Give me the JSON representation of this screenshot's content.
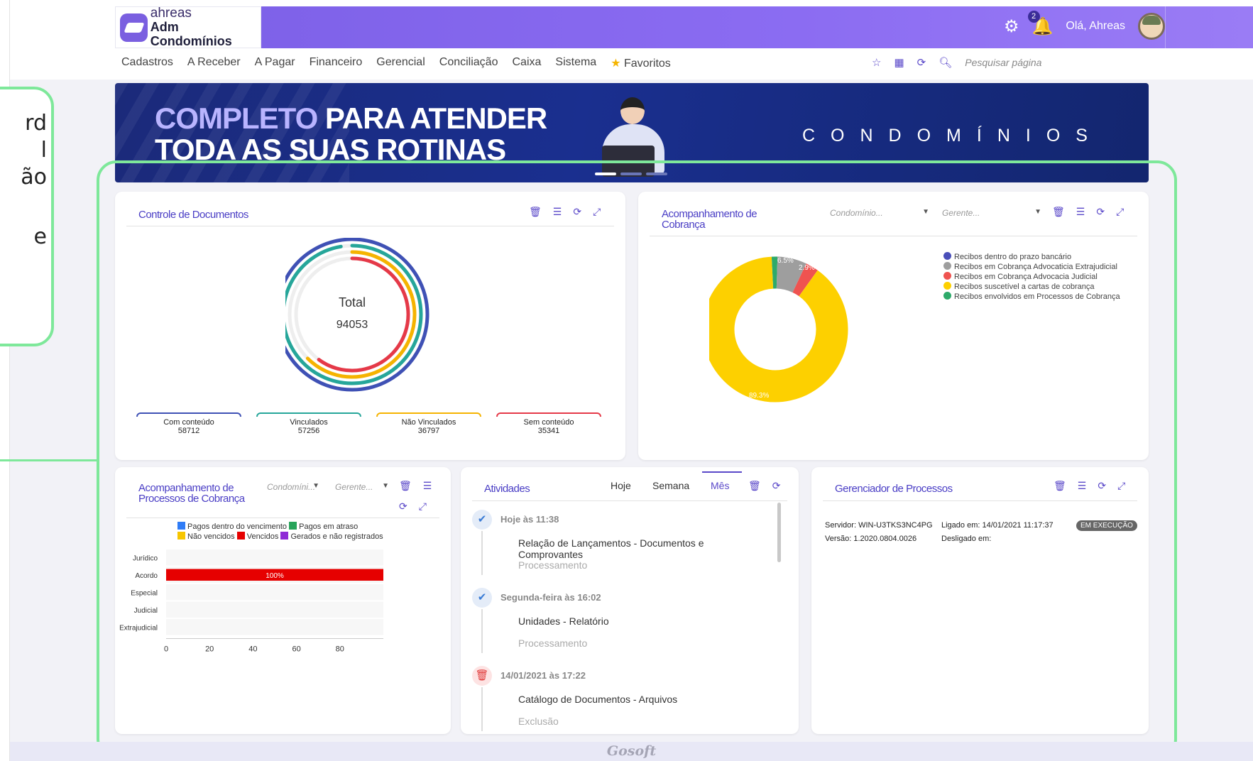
{
  "callout": {
    "lines": [
      "rd",
      "l",
      "ão",
      "",
      "e"
    ]
  },
  "header": {
    "brand_line1": "ahreas",
    "brand_line2": "Adm Condomínios",
    "notification_count": "2",
    "greeting": "Olá, Ahreas"
  },
  "menu": {
    "items": [
      "Cadastros",
      "A Receber",
      "A Pagar",
      "Financeiro",
      "Gerencial",
      "Conciliação",
      "Caixa",
      "Sistema"
    ],
    "favorites": "Favoritos",
    "search_placeholder": "Pesquisar página"
  },
  "banner": {
    "highlight": "COMPLETO",
    "line1_rest": " PARA ATENDER",
    "line2": "TODA AS SUAS ROTINAS",
    "right_text": "CONDOMÍNIOS"
  },
  "card_documentos": {
    "title": "Controle de Documentos",
    "center_label": "Total",
    "center_value": "94053",
    "legend": [
      {
        "label": "Com conteúdo",
        "value": "58712",
        "color": "#3f51b5"
      },
      {
        "label": "Vinculados",
        "value": "57256",
        "color": "#26a69a"
      },
      {
        "label": "Não Vinculados",
        "value": "36797",
        "color": "#f5b301"
      },
      {
        "label": "Sem conteúdo",
        "value": "35341",
        "color": "#e53948"
      }
    ]
  },
  "card_cobranca": {
    "title": "Acompanhamento de Cobrança",
    "select1": "Condomínio...",
    "select2": "Gerente...",
    "legend": [
      {
        "label": "Recibos dentro do prazo bancário",
        "color": "#4a4fb9"
      },
      {
        "label": "Recibos em Cobrança Advocaticia Extrajudicial",
        "color": "#9e9e9e"
      },
      {
        "label": "Recibos em Cobrança Advocacia Judicial",
        "color": "#ef5350"
      },
      {
        "label": "Recibos suscetível a cartas de cobrança",
        "color": "#fdd000"
      },
      {
        "label": "Recibos envolvidos em Processos de Cobrança",
        "color": "#2eaa6a"
      }
    ],
    "slices": [
      {
        "name": "Recibos envolvidos em Processos de Cobrança",
        "value": 1.3,
        "color": "#2eaa6a"
      },
      {
        "name": "Recibos em Cobrança Advocaticia Extrajudicial",
        "value": 6.5,
        "color": "#9e9e9e"
      },
      {
        "name": "Recibos em Cobrança Advocacia Judicial",
        "value": 2.9,
        "color": "#ef5350"
      },
      {
        "name": "Recibos suscetível a cartas de cobrança",
        "value": 89.3,
        "color": "#fdd000"
      }
    ],
    "slice_labels": [
      "6.5%",
      "2.9%",
      "89.3%"
    ]
  },
  "card_processos": {
    "title_line1": "Acompanhamento de",
    "title_line2": "Processos de Cobrança",
    "select1": "Condomíni...",
    "select2": "Gerente...",
    "legend": [
      {
        "label": "Pagos dentro do vencimento",
        "color": "#2f7cf6"
      },
      {
        "label": "Pagos em atraso",
        "color": "#27a45a"
      },
      {
        "label": "Não vencidos",
        "color": "#f7c600"
      },
      {
        "label": "Vencidos",
        "color": "#e60000"
      },
      {
        "label": "Gerados e não registrados",
        "color": "#8e2bd6"
      }
    ],
    "bar_label": "100%"
  },
  "chart_data": {
    "type": "bar",
    "orientation": "horizontal",
    "stacked": true,
    "categories": [
      "Jurídico",
      "Acordo",
      "Especial",
      "Judicial",
      "Extrajudicial"
    ],
    "series": [
      {
        "name": "Vencidos",
        "values": [
          0,
          100,
          0,
          0,
          0
        ]
      }
    ],
    "xticks": [
      "0",
      "20",
      "40",
      "60",
      "80"
    ],
    "xlim": [
      0,
      100
    ]
  },
  "card_atividades": {
    "title": "Atividades",
    "tabs": [
      "Hoje",
      "Semana",
      "Mês"
    ],
    "items": [
      {
        "time": "Hoje às 11:38",
        "desc": "Relação de Lançamentos - Documentos e Comprovantes",
        "status": "Processamento",
        "type": "check"
      },
      {
        "time": "Segunda-feira às 16:02",
        "desc": "Unidades - Relatório",
        "status": "Processamento",
        "type": "check"
      },
      {
        "time": "14/01/2021 às 17:22",
        "desc": "Catálogo de Documentos - Arquivos",
        "status": "Exclusão",
        "type": "delete"
      }
    ]
  },
  "card_gerenciador": {
    "title": "Gerenciador de Processos",
    "server_label": "Servidor:",
    "server_value": "WIN-U3TKS3NC4PG",
    "on_label": "Ligado em:",
    "on_value": "14/01/2021 11:17:37",
    "version_label": "Versão:",
    "version_value": "1.2020.0804.0026",
    "off_label": "Desligado em:",
    "status": "EM EXECUÇÃO"
  },
  "footer": {
    "brand": "Gosoft"
  }
}
